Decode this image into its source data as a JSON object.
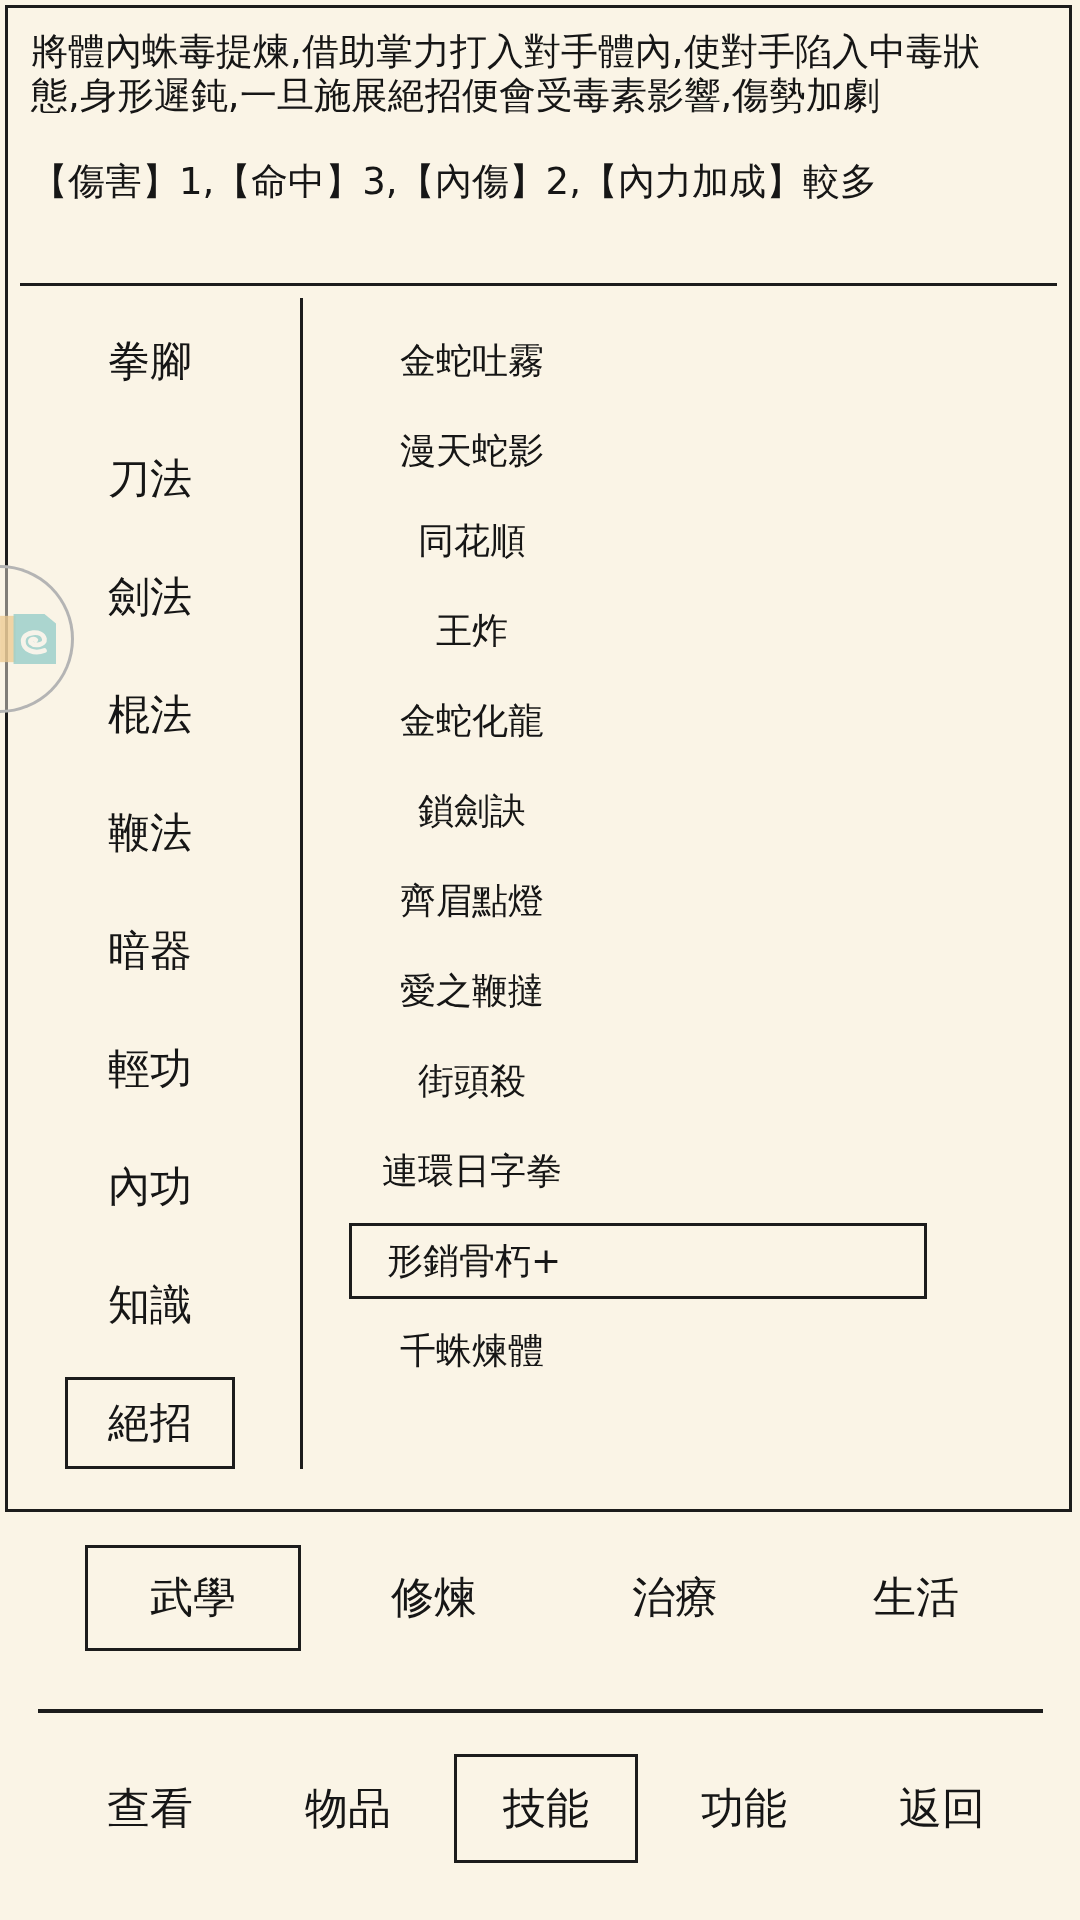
{
  "description": {
    "text": "將體內蛛毒提煉,借助掌力打入對手體內,使對手陷入中毒狀態,身形遲鈍,一旦施展絕招便會受毒素影響,傷勢加劇",
    "stats": "【傷害】1,【命中】3,【內傷】2,【內力加成】較多"
  },
  "categories": [
    {
      "label": "拳腳",
      "selected": false
    },
    {
      "label": "刀法",
      "selected": false
    },
    {
      "label": "劍法",
      "selected": false
    },
    {
      "label": "棍法",
      "selected": false
    },
    {
      "label": "鞭法",
      "selected": false
    },
    {
      "label": "暗器",
      "selected": false
    },
    {
      "label": "輕功",
      "selected": false
    },
    {
      "label": "內功",
      "selected": false
    },
    {
      "label": "知識",
      "selected": false
    },
    {
      "label": "絕招",
      "selected": true
    }
  ],
  "skills": [
    {
      "label": "金蛇吐霧",
      "selected": false
    },
    {
      "label": "漫天蛇影",
      "selected": false
    },
    {
      "label": "同花順",
      "selected": false
    },
    {
      "label": "王炸",
      "selected": false
    },
    {
      "label": "金蛇化龍",
      "selected": false
    },
    {
      "label": "鎖劍訣",
      "selected": false
    },
    {
      "label": "齊眉點燈",
      "selected": false
    },
    {
      "label": "愛之鞭撻",
      "selected": false
    },
    {
      "label": "街頭殺",
      "selected": false
    },
    {
      "label": "連環日字拳",
      "selected": false
    },
    {
      "label": "形銷骨朽+",
      "selected": true
    },
    {
      "label": "千蛛煉體",
      "selected": false
    }
  ],
  "tabs": [
    {
      "label": "武學",
      "selected": true
    },
    {
      "label": "修煉",
      "selected": false
    },
    {
      "label": "治療",
      "selected": false
    },
    {
      "label": "生活",
      "selected": false
    }
  ],
  "nav": [
    {
      "label": "查看",
      "selected": false
    },
    {
      "label": "物品",
      "selected": false
    },
    {
      "label": "技能",
      "selected": true
    },
    {
      "label": "功能",
      "selected": false
    },
    {
      "label": "返回",
      "selected": false
    }
  ]
}
